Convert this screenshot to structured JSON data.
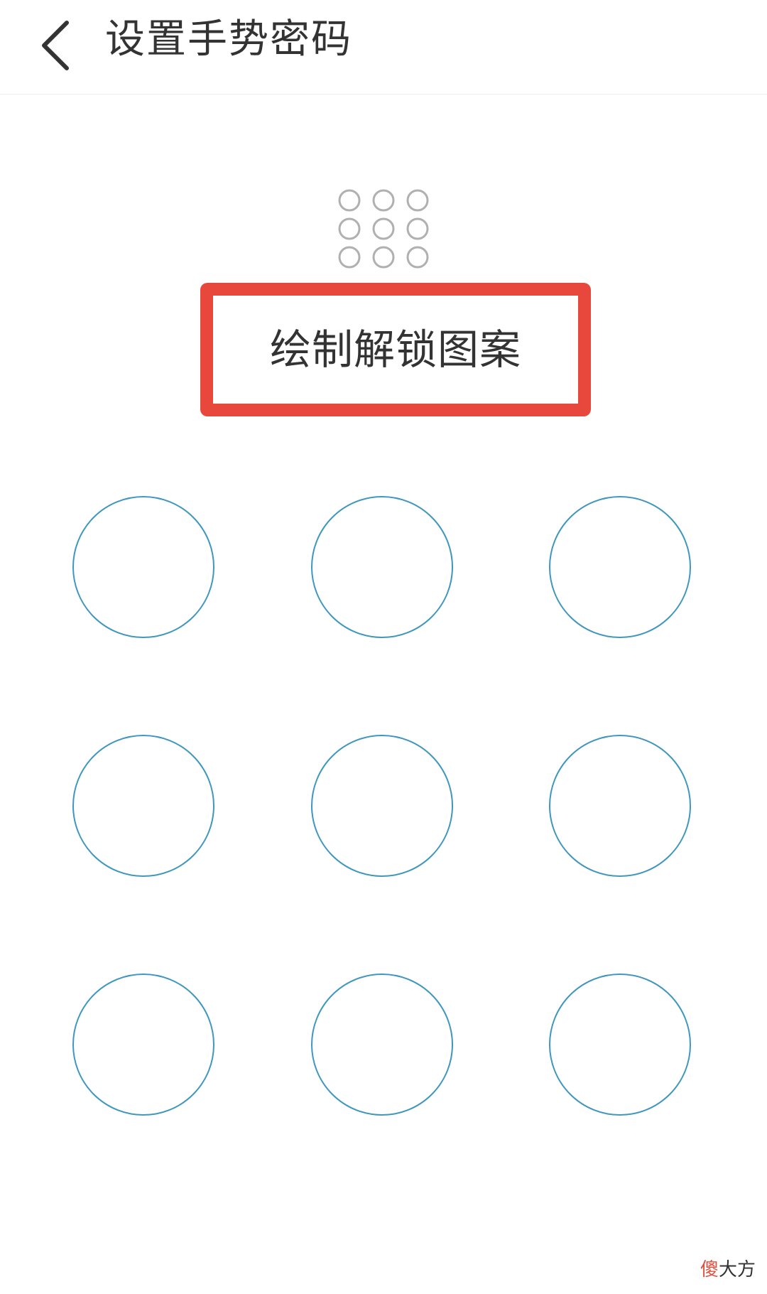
{
  "header": {
    "back_icon": "chevron-left-icon",
    "title": "设置手势密码"
  },
  "preview": {
    "grid": "3x3",
    "dot_color": "#b0b0b0"
  },
  "prompt": {
    "text": "绘制解锁图案",
    "highlight_color": "#e8483b"
  },
  "pattern_pad": {
    "rows": 3,
    "cols": 3,
    "ring_color": "#3f97bd",
    "selected": []
  },
  "watermark": {
    "accent": "傻",
    "rest": "大方"
  }
}
